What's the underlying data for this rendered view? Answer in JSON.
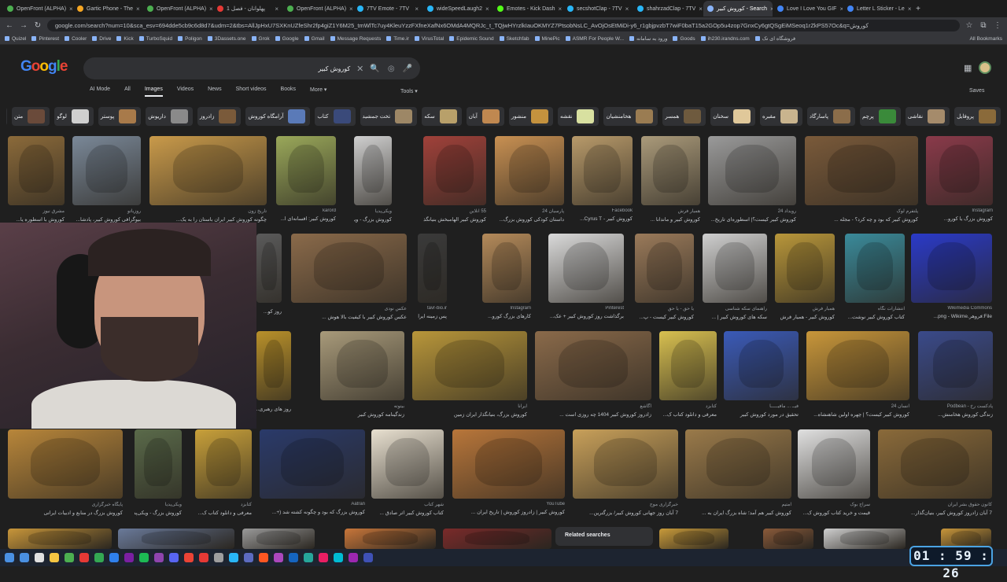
{
  "tabs": [
    {
      "label": "OpenFront (ALPHA)",
      "color": "#4caf50"
    },
    {
      "label": "Gartic Phone - The",
      "color": "#f5a623"
    },
    {
      "label": "OpenFront (ALPHA)",
      "color": "#4caf50"
    },
    {
      "label": "پهلوانان - فصل 1",
      "color": "#e53935"
    },
    {
      "label": "OpenFront (ALPHA)",
      "color": "#4caf50"
    },
    {
      "label": "7TV Emote - 7TV",
      "color": "#29b6f6"
    },
    {
      "label": "wideSpeedLaugh2",
      "color": "#29b6f6"
    },
    {
      "label": "Emotes - Kick Dash",
      "color": "#53fc18"
    },
    {
      "label": "secshotClap - 7TV",
      "color": "#29b6f6"
    },
    {
      "label": "shahrzadClap - 7TV",
      "color": "#29b6f6"
    },
    {
      "label": "کوروش کبیر - Search",
      "color": "#8ab4f8",
      "active": true
    },
    {
      "label": "Love I Love You GIF",
      "color": "#4285f4"
    },
    {
      "label": "Letter L Sticker - Le",
      "color": "#4285f4"
    }
  ],
  "new_tab": "+",
  "address": {
    "url": "google.com/search?num=10&sca_esv=694dde5cb9c6d8d7&udm=2&tbs=AllJpHxU7SXKnUZfeShr2fp4giZ1Y6M25_tmWlTc7uy4KleuYzzFXfneXafNx6OMdA4MQRJc_t_TQjwHYrzlkIauOKMYZ7PtsobNsLC_AvOjOsEtMiDi-y6_r1gbjpvzbT7wiF0baT15a2GOp5u4zop7GnxCy6gtQSgEiMSeoq1rZkPS57Oc&q=کوروش"
  },
  "bookmarks": [
    "Quizel",
    "Pinterest",
    "Cooler",
    "Drive",
    "Kick",
    "TurboSquid",
    "Poligon",
    "3Dassets.one",
    "Grok",
    "Google",
    "Gmail",
    "Message Requests",
    "Time.ir",
    "VirusTotal",
    "Epidemic Sound",
    "Sketchfab",
    "MinePic",
    "ASMR For People W...",
    "ورود به سامانه",
    "Goods",
    "ih230.irandns.com",
    "فروشگاه ای تک"
  ],
  "bookmarks_all": "All Bookmarks",
  "logo_letters": [
    {
      "c": "G",
      "col": "#4285f4"
    },
    {
      "c": "o",
      "col": "#ea4335"
    },
    {
      "c": "o",
      "col": "#fbbc05"
    },
    {
      "c": "g",
      "col": "#4285f4"
    },
    {
      "c": "l",
      "col": "#34a853"
    },
    {
      "c": "e",
      "col": "#ea4335"
    }
  ],
  "search": {
    "query": "کوروش کبیر",
    "clear": "✕",
    "mic": "🎤",
    "lens": "◎",
    "search": "🔍"
  },
  "filters": [
    "AI Mode",
    "All",
    "Images",
    "Videos",
    "News",
    "Short videos",
    "Books",
    "More ▾"
  ],
  "tools": "Tools ▾",
  "saves": "Saves",
  "chips": [
    {
      "label": "پروفایل",
      "color": "#8a6a3a"
    },
    {
      "label": "نقاشی",
      "color": "#a58b6b"
    },
    {
      "label": "پرچم",
      "color": "#3a8a3a"
    },
    {
      "label": "پاسارگاد",
      "color": "#8b6d4a"
    },
    {
      "label": "مقبره",
      "color": "#c9b48e"
    },
    {
      "label": "سخنان",
      "color": "#e0c89a"
    },
    {
      "label": "همسر",
      "color": "#6e5a3e"
    },
    {
      "label": "هخامنشیان",
      "color": "#9a7c52"
    },
    {
      "label": "نقشه",
      "color": "#d8e0a0"
    },
    {
      "label": "منشور",
      "color": "#c4923e"
    },
    {
      "label": "آبان",
      "color": "#c08850"
    },
    {
      "label": "سکه",
      "color": "#b8a06a"
    },
    {
      "label": "تخت جمشید",
      "color": "#9d8766"
    },
    {
      "label": "کتاب",
      "color": "#3a4a7a"
    },
    {
      "label": "آرامگاه کوروش",
      "color": "#5a7ab8"
    },
    {
      "label": "زادروز",
      "color": "#7a5a3a"
    },
    {
      "label": "داریوش",
      "color": "#8a8a8a"
    },
    {
      "label": "پوستر",
      "color": "#a87a4a"
    },
    {
      "label": "لوگو",
      "color": "#cfcfcf"
    },
    {
      "label": "متن",
      "color": "#6a4a3a"
    },
    {
      "label": "نماد",
      "color": "#d03030"
    }
  ],
  "rows": [
    {
      "items": [
        {
          "source": "مشرق نیوز",
          "caption": "کوروش با اسطوره یا...",
          "color": "#8b6a3a"
        },
        {
          "source": "روزیاتو",
          "caption": "بیوگرافی کوروش کبیر، پادشا...",
          "color": "#7a8898"
        },
        {
          "source": "تاریخ زون",
          "caption": "چگونه کوروش کبیر ایران باستان را به یک...",
          "color": "#c99a4a"
        },
        {
          "source": "karord",
          "caption": "کوروش کبیر: افسانه‌ای ا...",
          "color": "#9aa85a"
        },
        {
          "source": "ویکی‌پدیا",
          "caption": "کوروش بزرگ - ویکی‌پد...",
          "color": "#cfcfcf"
        },
        {
          "source": "55 آنلاین",
          "caption": "کوروش کبیر الهامبخش بنیانگذا...",
          "color": "#a0413a"
        },
        {
          "source": "پارسیان 24",
          "caption": "داستان کودکی کوروش بزرگ...",
          "color": "#c89052"
        },
        {
          "source": "Facebook",
          "caption": "کوروش کبیر - Cyrus T...",
          "color": "#b89a6a"
        },
        {
          "source": "همیار فرش",
          "caption": "کوروش کبیر و ماندانا ...",
          "color": "#aa9a7a"
        },
        {
          "source": "رویداد 24",
          "caption": "کوروش کبیر کیست؟| اسطوره‌ای تاریخ...",
          "color": "#9a9a9a"
        },
        {
          "source": "پلتفرم لوک",
          "caption": "کوروش کبیر که بود و چه کرد؟ - مجله ...",
          "color": "#7a5a3a"
        },
        {
          "source": "Instagram",
          "caption": "کوروش بزرگ یا کورو...",
          "color": "#8a3a4a"
        }
      ]
    },
    {
      "items": [
        {
          "source": "",
          "caption": "روز کو...",
          "color": "#5a5a5a"
        },
        {
          "source": "عکس نودی",
          "caption": "عکس کوروش کبیر با کیفیت بالا هوش ...",
          "color": "#8a6a4a"
        },
        {
          "source": "tavr-bio.ir",
          "caption": "پس زمینه ایران کورو...",
          "color": "#3a3a3a"
        },
        {
          "source": "Instagram",
          "caption": "کارهای بزرگ کورو...",
          "color": "#b48a5a"
        },
        {
          "source": "Pinterest",
          "caption": "برگذاشت روز کوروش کبیر + عک...",
          "color": "#dadada"
        },
        {
          "source": "یا حق - یا حق",
          "caption": "کوروش کبیر کیست - پ...",
          "color": "#9a7a5a"
        },
        {
          "source": "راهنمای سکه شناسی",
          "caption": "سکه های کوروش کبیر | ...",
          "color": "#cfcfcf"
        },
        {
          "source": "همیار فرش",
          "caption": "کوروش کبیر - همیار فرش",
          "color": "#b8963a"
        },
        {
          "source": "انتشارات نگاه",
          "caption": "کتاب کوروش کبیر نوشت...",
          "color": "#3a8a9a"
        },
        {
          "source": "Wikimedia Commons",
          "caption": "File:فروهر.png - Wikime...",
          "color": "#2a3ac8"
        }
      ]
    },
    {
      "items": [
        {
          "source": "",
          "caption": "روز های رهبری...",
          "color": "#b8902a"
        },
        {
          "source": "بیتوته",
          "caption": "زندگینامه کوروش کبیر",
          "color": "#a89a7a"
        },
        {
          "source": "ایرانا",
          "caption": "کوروش بزرگ، بنیانگذار ایران زمین",
          "color": "#b8963a"
        },
        {
          "source": "آگاشع",
          "caption": "زادروز کوروش کبیر 1404 چه روزی است ...",
          "color": "#8a6a4a"
        },
        {
          "source": "کتابزد",
          "caption": "معرفی و دانلود کتاب ک...",
          "color": "#d8c050"
        },
        {
          "source": "فیــ ... مافیـــــا",
          "caption": "تحقیق در مورد کوروش کبیر",
          "color": "#3a5ab8"
        },
        {
          "source": "انسان 24",
          "caption": "کوروش کبیر کیست؟ | چهره اولین شاهنشاه...",
          "color": "#c8963a"
        },
        {
          "source": "پادکست رخ - Podbean",
          "caption": "زندگی کوروش هخامنش...",
          "color": "#3a4a8a"
        }
      ]
    },
    {
      "items": [
        {
          "source": "پایگاه خبرگزاری",
          "caption": "کوروش بزرگ در منابع و ادبیات ایرانی",
          "color": "#b8863a"
        },
        {
          "source": "ویکی‌پدیا",
          "caption": "کوروش بزرگ - ویکی‌پد...",
          "color": "#5a6a4a"
        },
        {
          "source": "کتابزد",
          "caption": "معرفی و دانلود کتاب ک...",
          "color": "#c8a03a"
        },
        {
          "source": "Aatran",
          "caption": "کوروش بزرگ که بود و چگونه کشته شد (+...",
          "color": "#2a3a6a"
        },
        {
          "source": "شهر کتاب",
          "caption": "کتاب کوروش کبیر اثر صادق ...",
          "color": "#e8e0d0"
        },
        {
          "source": "YouTube",
          "caption": "کوروش کبیر | زادروز کوروش | تاریخ ایران ...",
          "color": "#b8763a"
        },
        {
          "source": "خبرگزاری موج",
          "caption": "7 آبان روز جهانی کوروش کبیر/ بزرگترین...",
          "color": "#c8a05a"
        },
        {
          "source": "آمتیم",
          "caption": "کوروش کبیر هم آمد؛ شاه بزرگ ایران به ...",
          "color": "#9a7a4a"
        },
        {
          "source": "سراج بوک",
          "caption": "قیمت و خرید کتاب کوروش ک...",
          "color": "#e0e0e0"
        },
        {
          "source": "کانون حقوق بشر ایران",
          "caption": "7 آبان زادروز کوروش کبیر، بنیان‌گذار...",
          "color": "#8a6a3a"
        }
      ]
    }
  ],
  "related_searches": "Related searches",
  "clock": "01 : 59 : 26",
  "taskbar_colors": [
    "#4a90e2",
    "#e0e0e0",
    "#f5c542",
    "#4caf50",
    "#e53935",
    "#34a853",
    "#2f80ed",
    "#7b1fa2",
    "#1db954",
    "#8e44ad",
    "#5865f2",
    "#ea4335",
    "#e53935",
    "#9e9e9e",
    "#29b6f6",
    "#5c6bc0",
    "#ff5722",
    "#ab47bc",
    "#1565c0",
    "#26a69a",
    "#e91e63",
    "#00bcd4",
    "#9c27b0",
    "#3f51b5"
  ]
}
